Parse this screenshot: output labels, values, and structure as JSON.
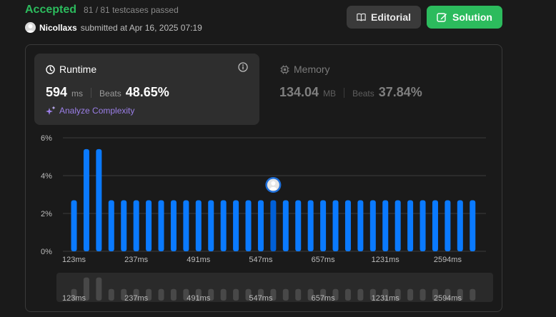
{
  "status": {
    "accepted": "Accepted",
    "cases": "81 / 81 testcases passed"
  },
  "submitter": {
    "name": "Nicollaxs",
    "text": "submitted at Apr 16, 2025 07:19"
  },
  "buttons": {
    "editorial": "Editorial",
    "solution": "Solution"
  },
  "runtime": {
    "title": "Runtime",
    "value": "594",
    "unit": "ms",
    "beats_label": "Beats",
    "beats_value": "48.65%",
    "analyze": "Analyze Complexity"
  },
  "memory": {
    "title": "Memory",
    "value": "134.04",
    "unit": "MB",
    "beats_label": "Beats",
    "beats_value": "37.84%"
  },
  "colors": {
    "accent_green": "#2cbb5d",
    "bar_blue": "#0a7aff",
    "analyze_purple": "#9b7fe8"
  },
  "chart_data": {
    "type": "bar",
    "ylim": [
      0,
      6
    ],
    "yticks": [
      "6%",
      "4%",
      "2%",
      "0%"
    ],
    "ytick_values": [
      6,
      4,
      2,
      0
    ],
    "xtick_labels": [
      "123ms",
      "237ms",
      "491ms",
      "547ms",
      "657ms",
      "1231ms",
      "2594ms"
    ],
    "xtick_bar_index": [
      0,
      5,
      10,
      15,
      20,
      25,
      30
    ],
    "values": [
      2.7,
      5.4,
      5.4,
      2.7,
      2.7,
      2.7,
      2.7,
      2.7,
      2.7,
      2.7,
      2.7,
      2.7,
      2.7,
      2.7,
      2.7,
      2.7,
      2.7,
      2.7,
      2.7,
      2.7,
      2.7,
      2.7,
      2.7,
      2.7,
      2.7,
      2.7,
      2.7,
      2.7,
      2.7,
      2.7,
      2.7,
      2.7,
      2.7
    ],
    "highlight_index": 16,
    "grid": true
  }
}
